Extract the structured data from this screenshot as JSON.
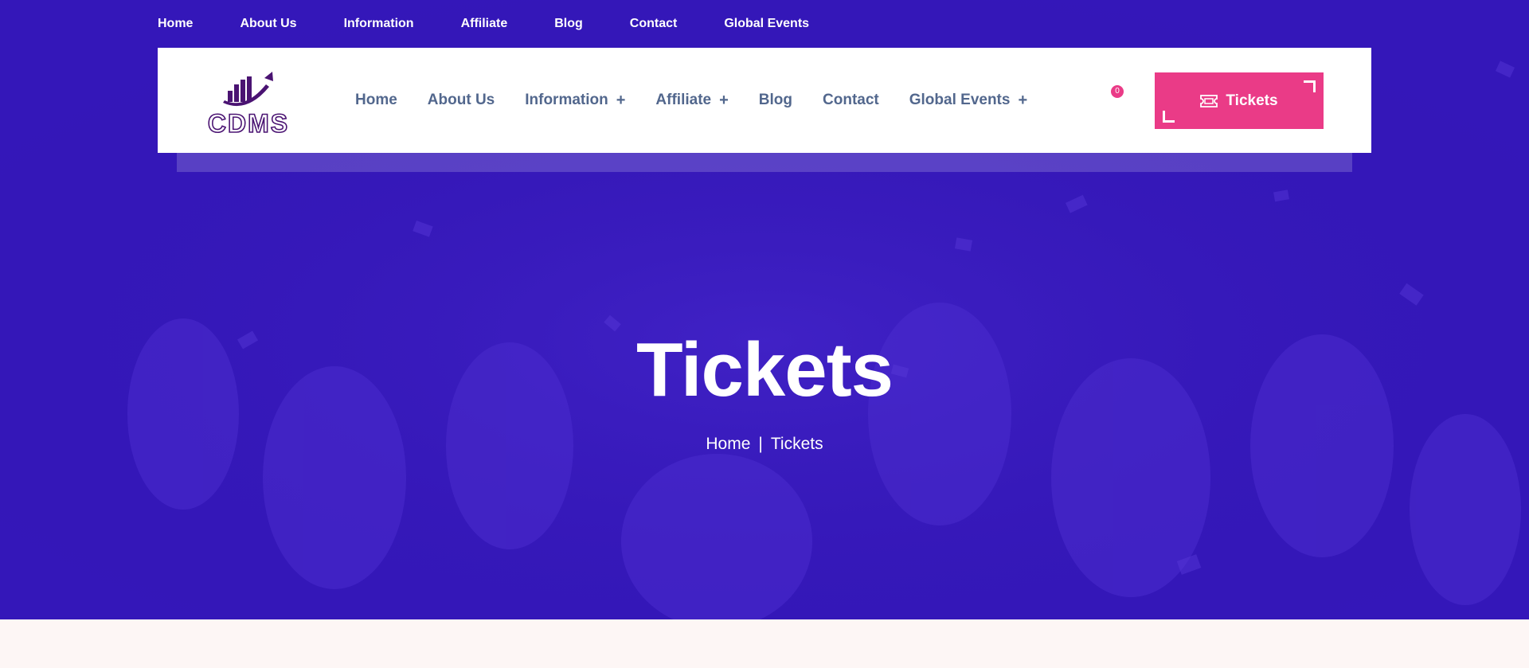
{
  "topbar": {
    "links": [
      "Home",
      "About Us",
      "Information",
      "Affiliate",
      "Blog",
      "Contact",
      "Global Events"
    ]
  },
  "header": {
    "logo_text": "CDMS",
    "nav": [
      {
        "label": "Home",
        "has_submenu": false
      },
      {
        "label": "About Us",
        "has_submenu": false
      },
      {
        "label": "Information",
        "has_submenu": true
      },
      {
        "label": "Affiliate",
        "has_submenu": true
      },
      {
        "label": "Blog",
        "has_submenu": false
      },
      {
        "label": "Contact",
        "has_submenu": false
      },
      {
        "label": "Global Events",
        "has_submenu": true
      }
    ],
    "submenu_symbol": "+",
    "cart_count": "0",
    "tickets_button": "Tickets"
  },
  "hero": {
    "title": "Tickets",
    "breadcrumb": {
      "home": "Home",
      "separator": "|",
      "current": "Tickets"
    }
  },
  "colors": {
    "hero_bg": "#3417b9",
    "accent": "#ea3b87",
    "nav_text": "#52678d",
    "logo": "#4a1372"
  }
}
